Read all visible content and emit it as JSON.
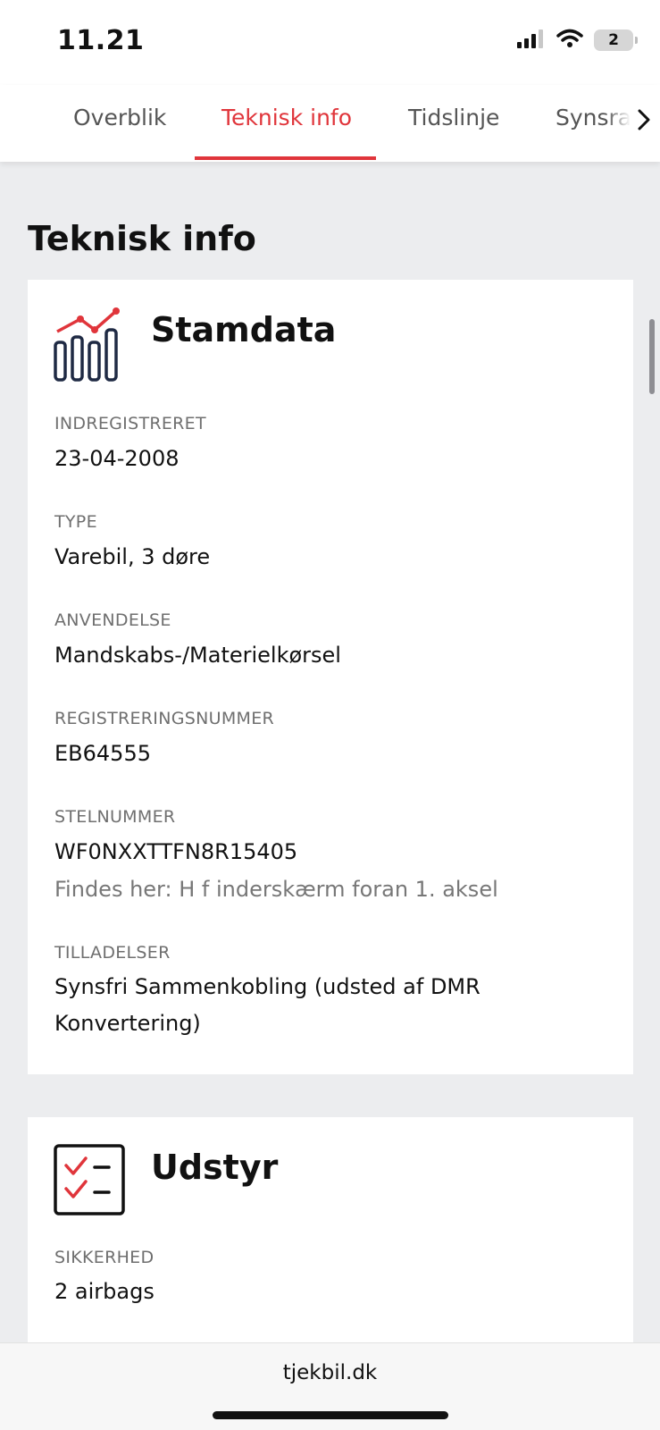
{
  "status_bar": {
    "time": "11.21",
    "battery_level": "2"
  },
  "tabs": [
    {
      "label": "Overblik",
      "active": false
    },
    {
      "label": "Teknisk info",
      "active": true
    },
    {
      "label": "Tidslinje",
      "active": false
    },
    {
      "label": "Synsrapporter",
      "active": false
    }
  ],
  "page": {
    "title": "Teknisk info"
  },
  "stamdata": {
    "title": "Stamdata",
    "icon": "chart-icon",
    "fields": [
      {
        "label": "INDREGISTRERET",
        "value": "23-04-2008"
      },
      {
        "label": "TYPE",
        "value": "Varebil, 3 døre"
      },
      {
        "label": "ANVENDELSE",
        "value": "Mandskabs-/Materielkørsel"
      },
      {
        "label": "REGISTRERINGSNUMMER",
        "value": "EB64555"
      },
      {
        "label": "STELNUMMER",
        "value": "WF0NXXTTFN8R15405",
        "note": "Findes her: H f inderskærm foran 1. aksel"
      },
      {
        "label": "TILLADELSER",
        "value": "Synsfri Sammenkobling (udsted af DMR Konvertering)"
      }
    ]
  },
  "udstyr": {
    "title": "Udstyr",
    "icon": "checklist-icon",
    "fields": [
      {
        "label": "SIKKERHED",
        "value": "2 airbags"
      }
    ]
  },
  "browser": {
    "url": "tjekbil.dk"
  },
  "colors": {
    "accent": "#e0353b",
    "navy": "#1f2a44"
  }
}
